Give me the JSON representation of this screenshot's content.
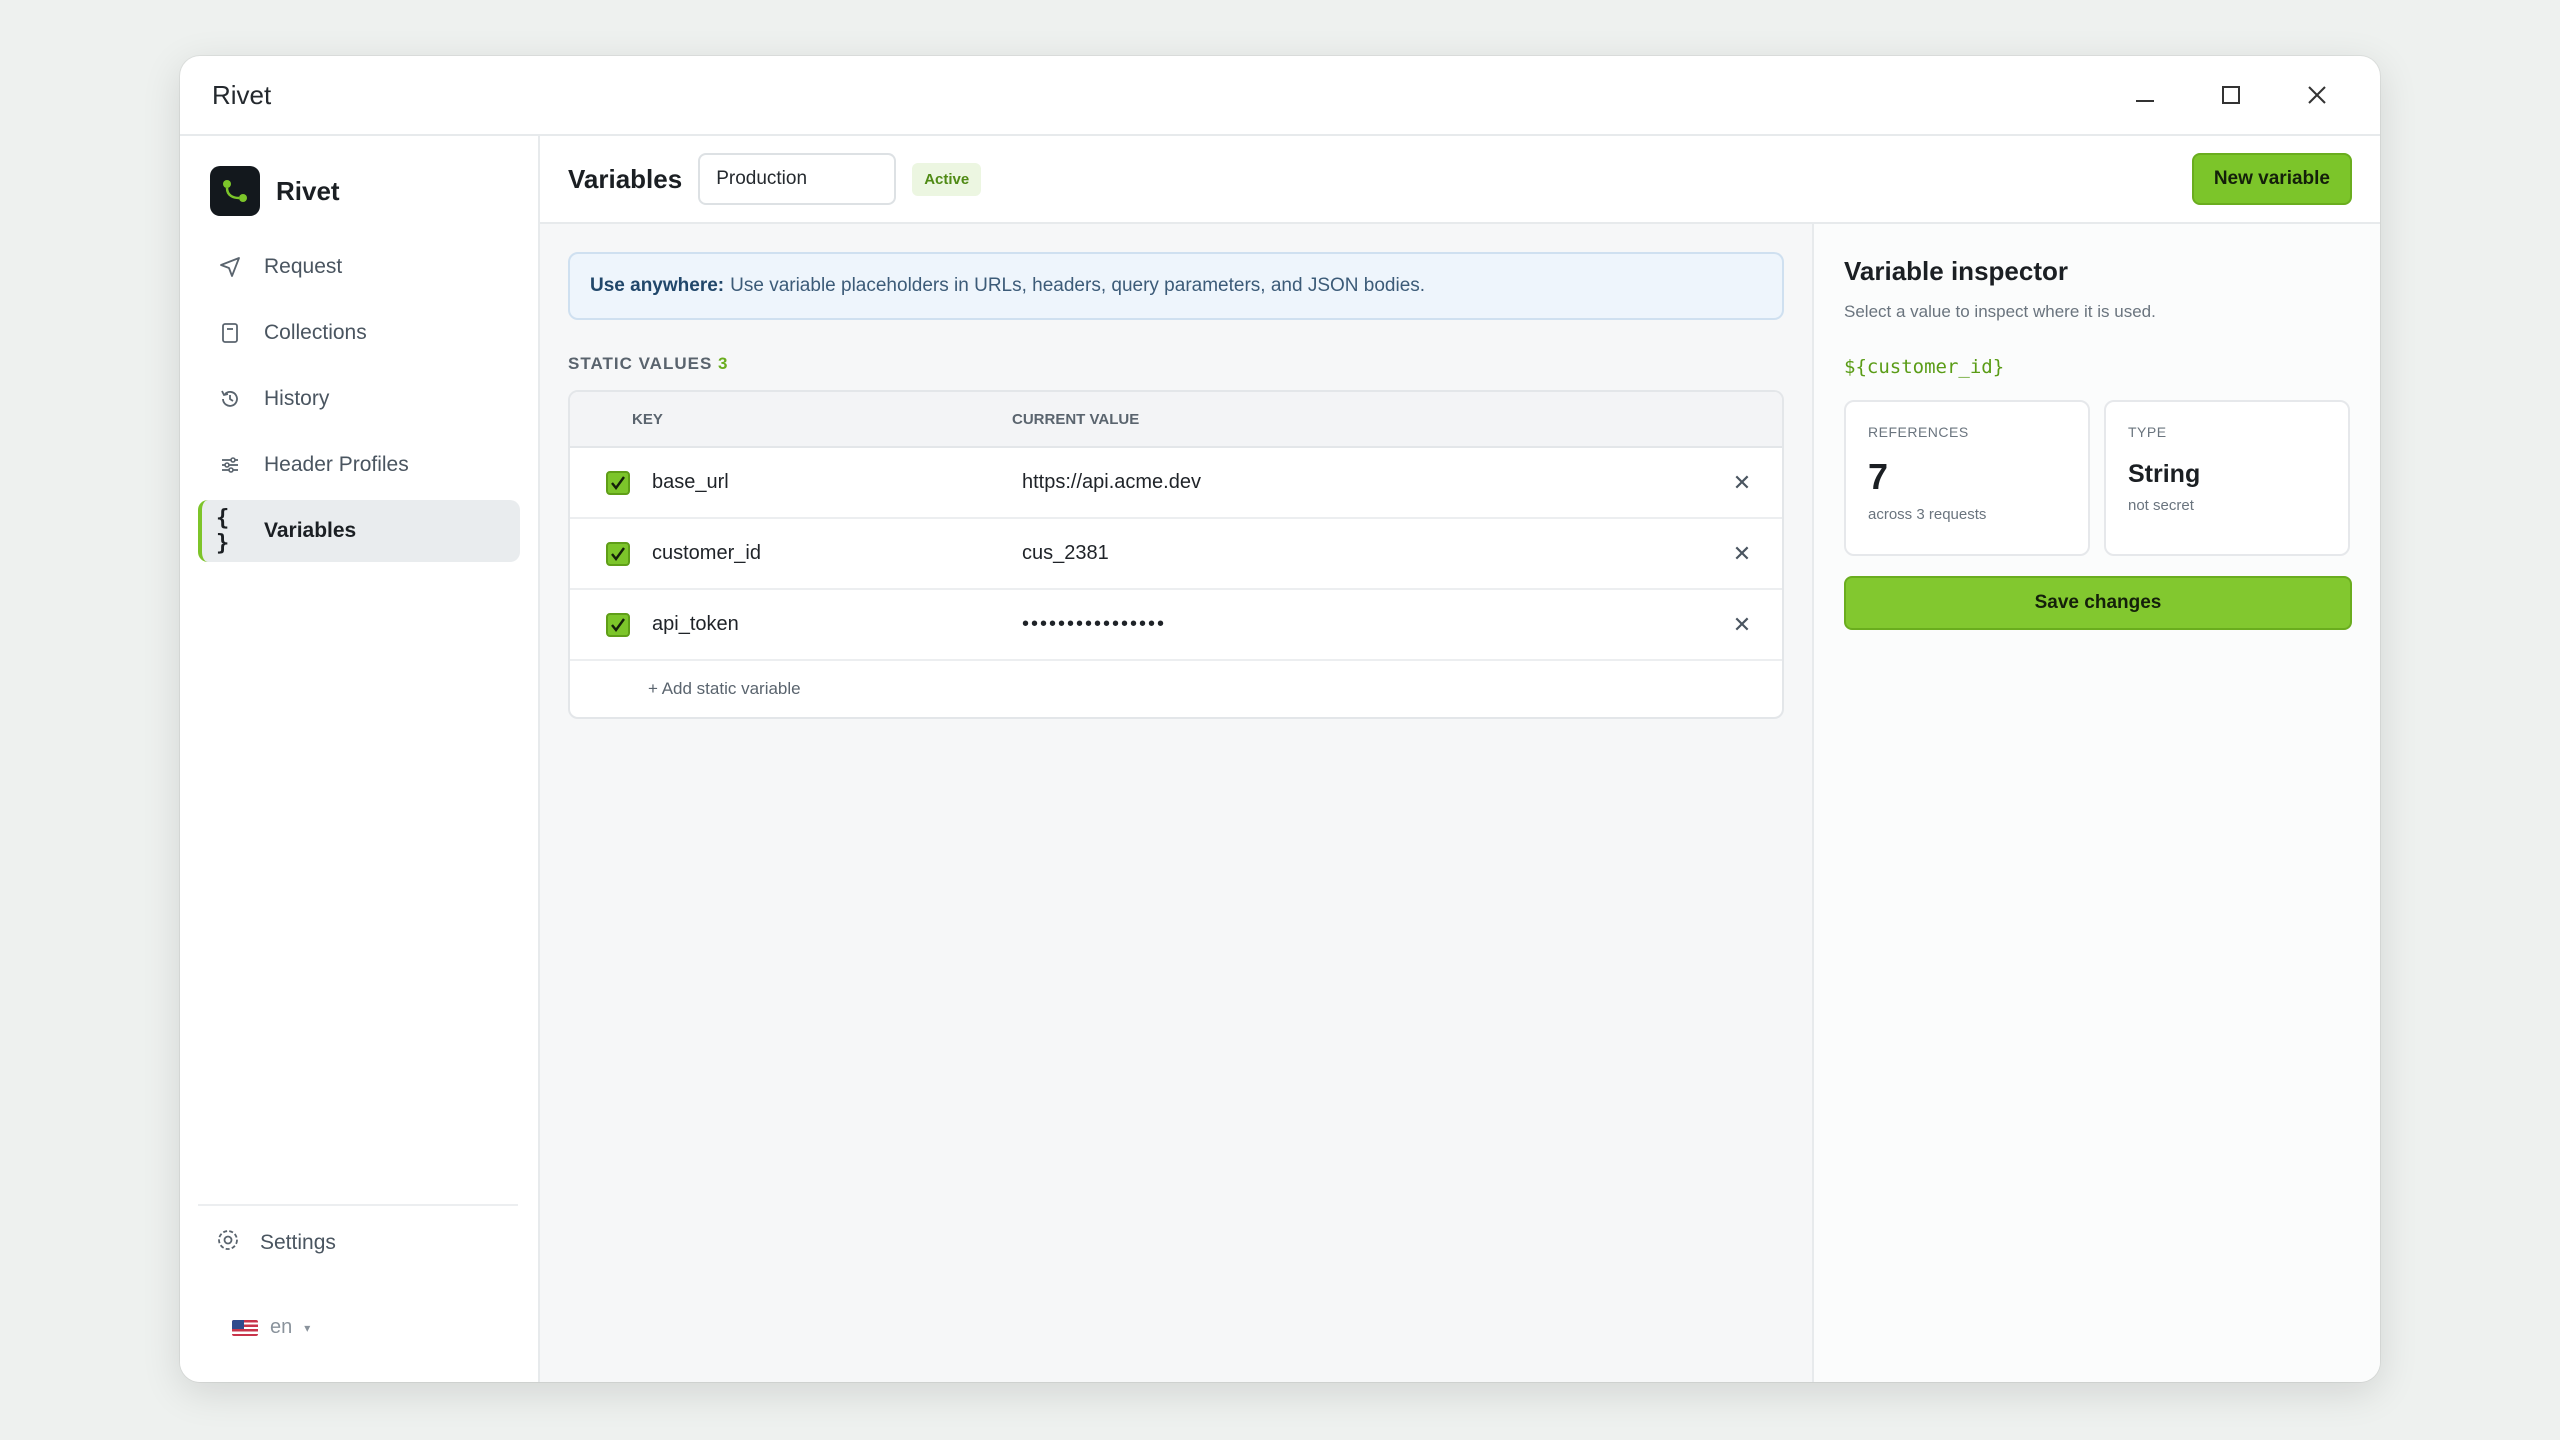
{
  "window": {
    "title": "Rivet"
  },
  "sidebar": {
    "brand": "Rivet",
    "items": [
      {
        "label": "Request",
        "icon": "send-icon"
      },
      {
        "label": "Collections",
        "icon": "book-icon"
      },
      {
        "label": "History",
        "icon": "history-icon"
      },
      {
        "label": "Header Profiles",
        "icon": "sliders-icon"
      },
      {
        "label": "Variables",
        "icon": "braces-icon",
        "active": true
      }
    ],
    "settings": "Settings",
    "language": "en"
  },
  "header": {
    "title": "Variables",
    "environment": "Production",
    "status": "Active",
    "new_button": "New variable"
  },
  "notice": {
    "lead": "Use anywhere:",
    "text": "Use variable placeholders in URLs, headers, query parameters, and JSON bodies."
  },
  "static_values": {
    "label": "STATIC VALUES",
    "count": "3",
    "columns": {
      "key": "KEY",
      "value": "CURRENT VALUE"
    },
    "rows": [
      {
        "key": "base_url",
        "value": "https://api.acme.dev",
        "enabled": true
      },
      {
        "key": "customer_id",
        "value": "cus_2381",
        "enabled": true
      },
      {
        "key": "api_token",
        "value": "••••••••••••••••",
        "enabled": true,
        "secret": true
      }
    ],
    "add_label": "+ Add static variable"
  },
  "inspector": {
    "title": "Variable inspector",
    "subtitle": "Select a value to inspect where it is used.",
    "variable": "${customer_id}",
    "references": {
      "label": "REFERENCES",
      "value": "7",
      "note": "across 3 requests"
    },
    "type": {
      "label": "TYPE",
      "value": "String",
      "note": "not secret"
    },
    "save_button": "Save changes"
  },
  "colors": {
    "accent": "#7cc52a",
    "info_bg": "#eef5fc",
    "badge_text": "#4f8a14"
  }
}
